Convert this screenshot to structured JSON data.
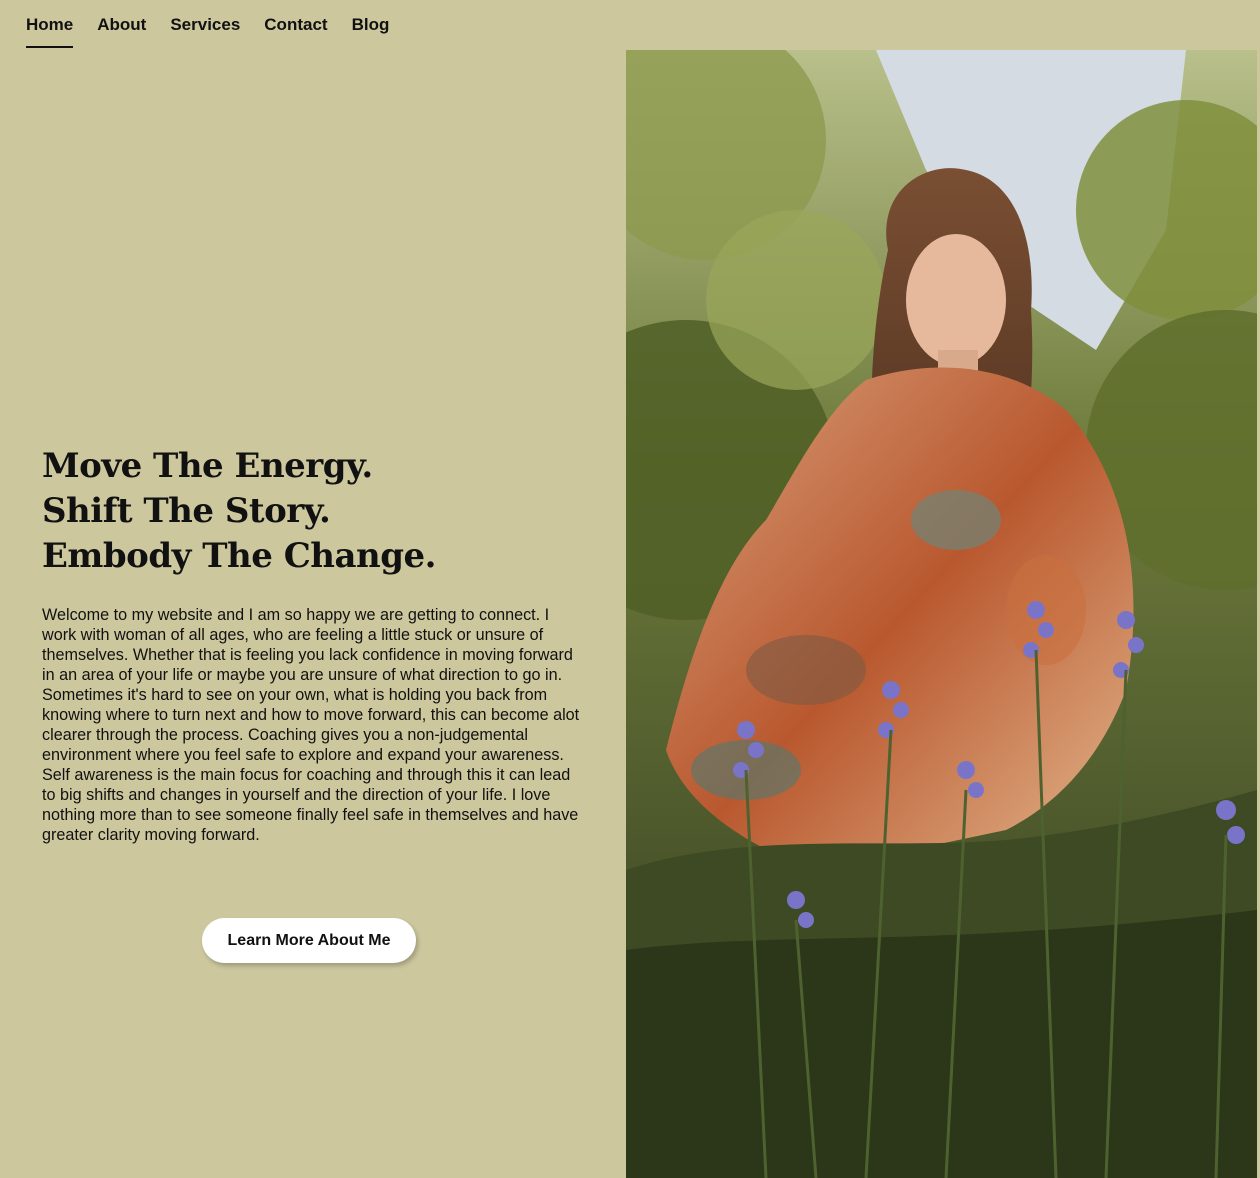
{
  "nav": {
    "items": [
      {
        "label": "Home",
        "active": true
      },
      {
        "label": "About",
        "active": false
      },
      {
        "label": "Services",
        "active": false
      },
      {
        "label": "Contact",
        "active": false
      },
      {
        "label": "Blog",
        "active": false
      }
    ]
  },
  "hero": {
    "headline": [
      "Move The Energy.",
      "Shift The Story.",
      "Embody The Change."
    ],
    "intro": "Welcome to my website and I am so happy we are getting to connect. I work with woman of all ages, who are feeling a little stuck or unsure of themselves. Whether that is feeling you lack confidence in moving forward in an area of your life or maybe you are unsure of what direction to go in. Sometimes it's hard to see on your own, what is holding you back from knowing where to turn next and how to move forward, this can become alot clearer through the process. Coaching gives you a non-judgemental environment where you feel safe to explore and expand your awareness. Self awareness is the main focus for coaching and through this it can lead to big shifts and changes in yourself and the direction of your life. I love nothing more than to see someone finally feel safe in themselves and have greater clarity moving forward.",
    "cta_label": "Learn More About Me"
  },
  "colors": {
    "background": "#cdc79e",
    "text": "#111111",
    "button_bg": "#ffffff"
  },
  "photo": {
    "icon": "portrait-photo"
  }
}
